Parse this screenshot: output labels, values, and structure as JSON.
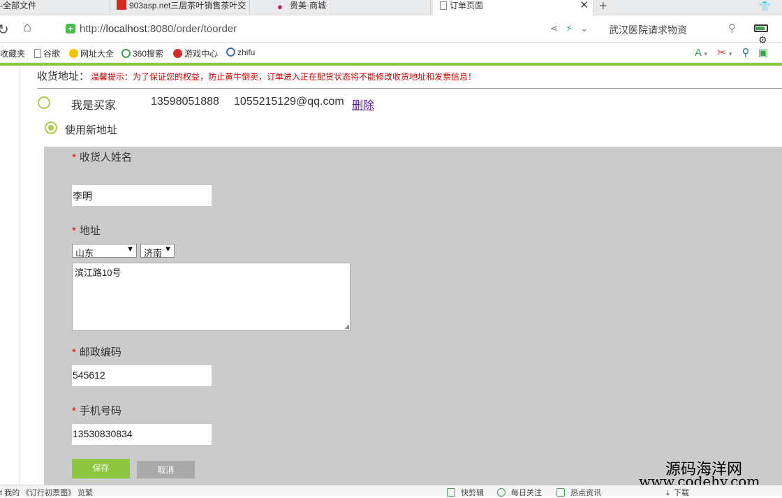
{
  "tabs": [
    {
      "label": "-全部文件",
      "active": false
    },
    {
      "label": "903asp.net三层茶叶销售茶叶交",
      "active": false
    },
    {
      "label": "贵美·商城",
      "active": false
    },
    {
      "label": "订单页面",
      "active": true
    }
  ],
  "address_bar": {
    "url_prefix": "http://",
    "url_host": "localhost",
    "url_rest": ":8080/order/toorder",
    "search_text": "武汉医院请求物资"
  },
  "bookmarks": [
    "收藏夹",
    "谷歌",
    "网址大全",
    "360搜索",
    "游戏中心",
    "zhifu"
  ],
  "page": {
    "section_title": "收货地址：",
    "hint": "温馨提示：为了保证您的权益，防止黄牛倒卖，订单进入正在配货状态将不能修改收货地址和发票信息！",
    "existing_address": {
      "name": "我是买家",
      "phone": "13598051888",
      "email": "1055215129@qq.com",
      "delete_label": "删除"
    },
    "new_address_label": "使用新地址",
    "form": {
      "name_label": "收货人姓名",
      "name_value": "李明",
      "address_label": "地址",
      "province": "山东",
      "city": "济南",
      "street": "滨江路10号",
      "postcode_label": "邮政编码",
      "postcode_value": "545612",
      "mobile_label": "手机号码",
      "mobile_value": "13530830834",
      "save_label": "保存",
      "cancel_label": "取消"
    }
  },
  "watermark": {
    "line1": "源码海洋网",
    "line2": "www.codehy.com"
  },
  "status_bar": {
    "left_text": "t 我的 《订行初票图》 览繁",
    "items": [
      "快剪辑",
      "每日关注",
      "热点资讯",
      "下载"
    ]
  },
  "colors": {
    "accent_green": "#8dc63f",
    "hint_red": "#d40000",
    "panel_gray": "#cbcbcb"
  }
}
